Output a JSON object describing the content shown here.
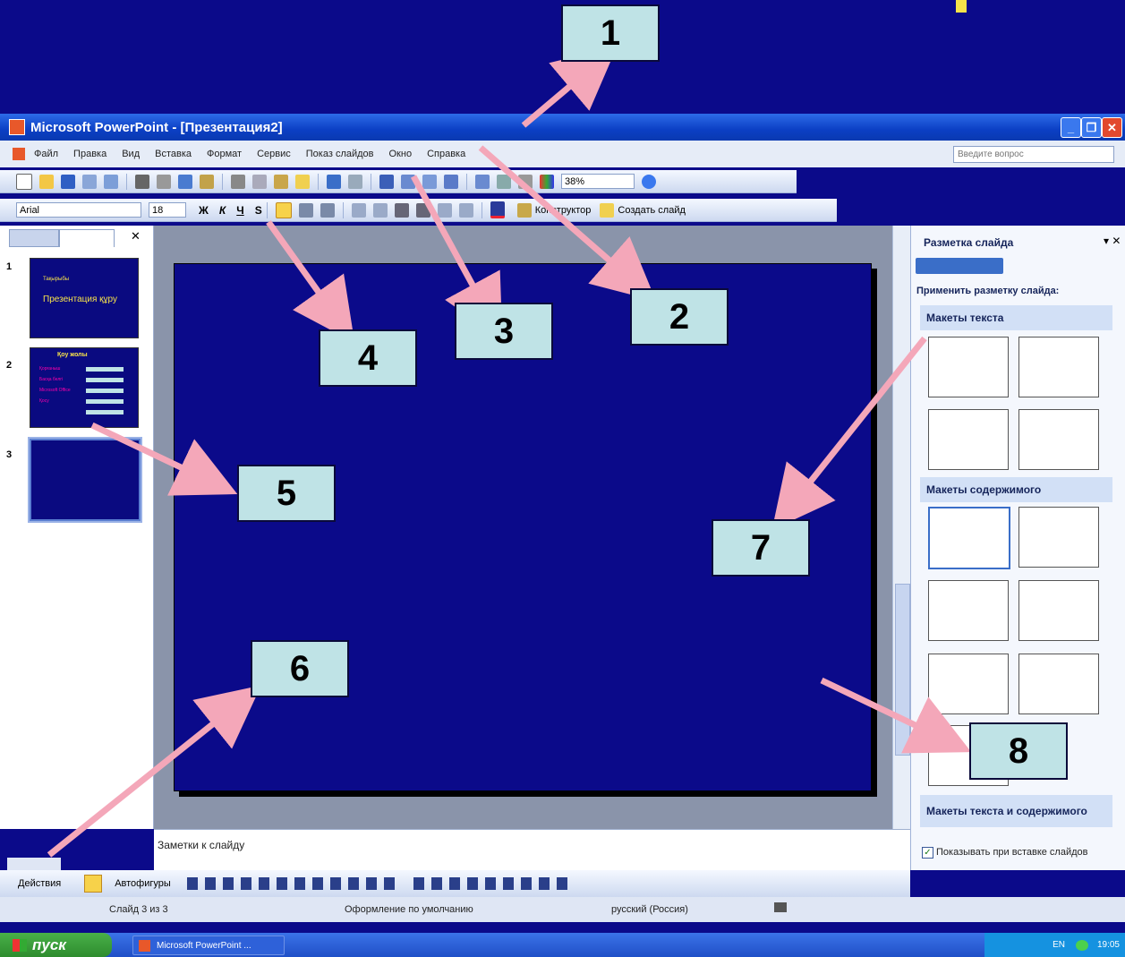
{
  "window": {
    "title": "Microsoft PowerPoint - [Презентация2]",
    "min": "_",
    "restore": "❐",
    "close": "✕"
  },
  "menu": {
    "items": [
      "Файл",
      "Правка",
      "Вид",
      "Вставка",
      "Формат",
      "Сервис",
      "Показ слайдов",
      "Окно",
      "Справка"
    ],
    "help_placeholder": "Введите вопрос"
  },
  "toolbar": {
    "zoom": "38%",
    "font": "Arial",
    "font_size": "18",
    "bold": "Ж",
    "italic": "К",
    "underline": "Ч",
    "shadow": "S",
    "designer": "Конструктор",
    "new_slide": "Создать слайд"
  },
  "slides_pane": {
    "slides": [
      {
        "num": "1",
        "line1": "Тақырыбы",
        "line2": "Презентация құру"
      },
      {
        "num": "2",
        "title": "Қоу жолы",
        "rows": [
          "Қорғаныш",
          "Басқа белгі",
          "Microsoft Office",
          "Қосу"
        ]
      },
      {
        "num": "3"
      }
    ]
  },
  "notes": "Заметки к слайду",
  "task_pane": {
    "title": "Разметка слайда",
    "apply": "Применить разметку слайда:",
    "sections": [
      "Макеты текста",
      "Макеты содержимого",
      "Макеты текста и содержимого"
    ],
    "checkbox": "Показывать при вставке слайдов"
  },
  "drawing": {
    "actions": "Действия",
    "autoshapes": "Автофигуры"
  },
  "status": {
    "slide": "Слайд 3 из 3",
    "design": "Оформление по умолчанию",
    "lang": "русский (Россия)"
  },
  "taskbar": {
    "start": "пуск",
    "app": "Microsoft PowerPoint ...",
    "lang": "EN",
    "time": "19:05"
  },
  "callouts": [
    "1",
    "2",
    "3",
    "4",
    "5",
    "6",
    "7",
    "8"
  ],
  "colors": {
    "background": "#0b0a8a",
    "callout": "#bfe3e6",
    "arrow": "#f4a7b9"
  }
}
